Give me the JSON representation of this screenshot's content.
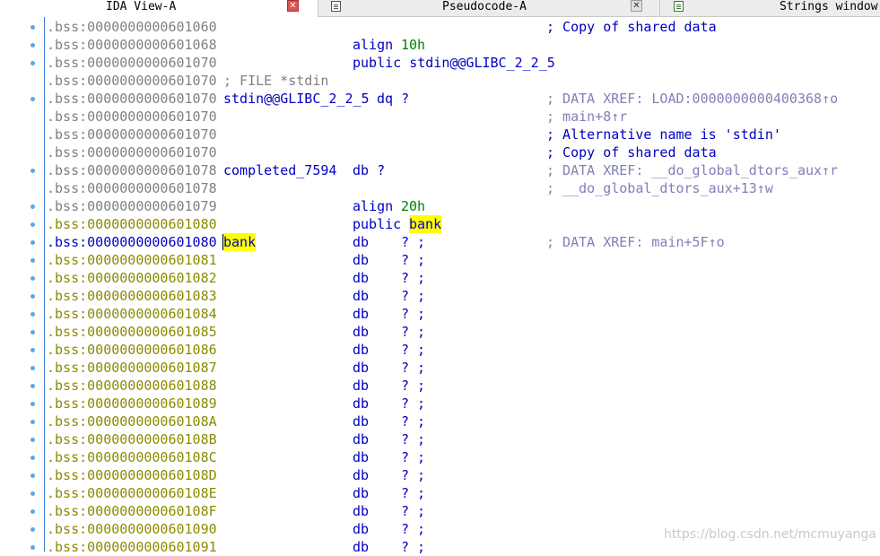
{
  "tabs": [
    {
      "label": "IDA View-A",
      "active": true,
      "close": "red"
    },
    {
      "label": "Pseudocode-A",
      "active": false,
      "close": "grey"
    },
    {
      "label": "Strings window",
      "active": false,
      "close": null
    }
  ],
  "rows": [
    {
      "addr": ".bss:0000000000601060",
      "kind": "comment_only",
      "comment": "; Copy of shared data",
      "comment_style": "blue"
    },
    {
      "addr": ".bss:0000000000601068",
      "kind": "directive",
      "mnem": "align",
      "operand": "10h"
    },
    {
      "addr": ".bss:0000000000601070",
      "kind": "directive",
      "mnem": "public stdin@@GLIBC_2_2_5",
      "operand": ""
    },
    {
      "addr": ".bss:0000000000601070",
      "kind": "file",
      "text": "; FILE *stdin"
    },
    {
      "addr": ".bss:0000000000601070",
      "kind": "data",
      "label": "stdin@@GLIBC_2_2_5",
      "mnem": "dq ?",
      "comment": "; DATA XREF: LOAD:0000000000400368↑o",
      "comment_style": "gray"
    },
    {
      "addr": ".bss:0000000000601070",
      "kind": "comment_only",
      "comment": "; main+8↑r",
      "comment_style": "gray"
    },
    {
      "addr": ".bss:0000000000601070",
      "kind": "comment_only",
      "comment": "; Alternative name is 'stdin'",
      "comment_style": "blue"
    },
    {
      "addr": ".bss:0000000000601070",
      "kind": "comment_only",
      "comment": "; Copy of shared data",
      "comment_style": "blue"
    },
    {
      "addr": ".bss:0000000000601078",
      "kind": "data",
      "label": "completed_7594",
      "mnem": "db ?",
      "comment": "; DATA XREF: __do_global_dtors_aux↑r",
      "comment_style": "gray"
    },
    {
      "addr": ".bss:0000000000601078",
      "kind": "comment_only",
      "comment": "; __do_global_dtors_aux+13↑w",
      "comment_style": "gray"
    },
    {
      "addr": ".bss:0000000000601079",
      "kind": "directive",
      "mnem": "align",
      "operand": "20h"
    },
    {
      "addr": ".bss:0000000000601080",
      "kind": "public_bank",
      "mnem": "public",
      "operand": "bank"
    },
    {
      "addr": ".bss:0000000000601080",
      "kind": "bank_def",
      "label": "bank",
      "mnem": "db",
      "operand": "? ;",
      "comment": "; DATA XREF: main+5F↑o",
      "comment_style": "gray"
    },
    {
      "addr": ".bss:0000000000601081",
      "kind": "db"
    },
    {
      "addr": ".bss:0000000000601082",
      "kind": "db"
    },
    {
      "addr": ".bss:0000000000601083",
      "kind": "db"
    },
    {
      "addr": ".bss:0000000000601084",
      "kind": "db"
    },
    {
      "addr": ".bss:0000000000601085",
      "kind": "db"
    },
    {
      "addr": ".bss:0000000000601086",
      "kind": "db"
    },
    {
      "addr": ".bss:0000000000601087",
      "kind": "db"
    },
    {
      "addr": ".bss:0000000000601088",
      "kind": "db"
    },
    {
      "addr": ".bss:0000000000601089",
      "kind": "db"
    },
    {
      "addr": ".bss:000000000060108A",
      "kind": "db"
    },
    {
      "addr": ".bss:000000000060108B",
      "kind": "db"
    },
    {
      "addr": ".bss:000000000060108C",
      "kind": "db"
    },
    {
      "addr": ".bss:000000000060108D",
      "kind": "db"
    },
    {
      "addr": ".bss:000000000060108E",
      "kind": "db"
    },
    {
      "addr": ".bss:000000000060108F",
      "kind": "db"
    },
    {
      "addr": ".bss:0000000000601090",
      "kind": "db"
    },
    {
      "addr": ".bss:0000000000601091",
      "kind": "db"
    }
  ],
  "db_mnem": "db",
  "db_operand": "? ;",
  "watermark": "https://blog.csdn.net/mcmuyanga",
  "colors": {
    "gutter_line": "#3d7bd6",
    "highlight": "#ffff00",
    "address_data": "#8b8b00",
    "address_plain": "#808080",
    "code_blue": "#0000c0",
    "number_green": "#008000",
    "xref_comment": "#8080b8"
  }
}
